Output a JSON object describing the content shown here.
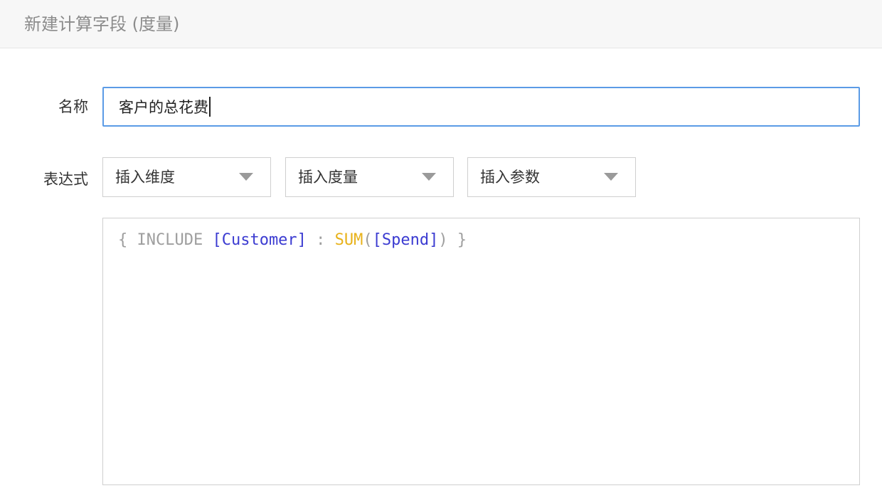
{
  "dialog": {
    "title": "新建计算字段 (度量)"
  },
  "name_row": {
    "label": "名称",
    "input_value": "客户的总花费"
  },
  "expression_row": {
    "label": "表达式",
    "dropdowns": [
      {
        "label": "插入维度",
        "icon": "chevron-down-icon"
      },
      {
        "label": "插入度量",
        "icon": "chevron-down-icon"
      },
      {
        "label": "插入参数",
        "icon": "chevron-down-icon"
      }
    ],
    "code_tokens": [
      {
        "text": "{ ",
        "kind": "punct"
      },
      {
        "text": "INCLUDE",
        "kind": "keyword"
      },
      {
        "text": " ",
        "kind": "punct"
      },
      {
        "text": "[Customer]",
        "kind": "field"
      },
      {
        "text": " : ",
        "kind": "punct"
      },
      {
        "text": "SUM",
        "kind": "func"
      },
      {
        "text": "(",
        "kind": "punct"
      },
      {
        "text": "[Spend]",
        "kind": "field"
      },
      {
        "text": ") }",
        "kind": "punct"
      }
    ]
  },
  "colors": {
    "input_focus_border": "#5b9be6",
    "field_token": "#3b3bd1",
    "func_token": "#e8b21a",
    "keyword_token": "#9e9e9e"
  }
}
